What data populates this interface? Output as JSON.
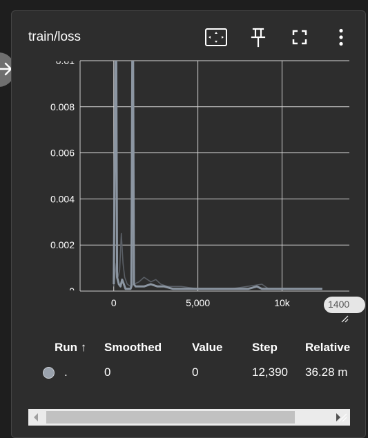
{
  "card": {
    "title": "train/loss"
  },
  "toolbar": {
    "fit_icon": "fit-domain-icon",
    "pin_icon": "pin-icon",
    "fullscreen_icon": "fullscreen-icon",
    "more_icon": "more-vert-icon"
  },
  "sidebar_toggle_icon": "arrow-right-icon",
  "chart_data": {
    "type": "line",
    "title": "",
    "xlabel": "",
    "ylabel": "",
    "xlim": [
      -2000,
      14000
    ],
    "ylim": [
      0,
      0.01
    ],
    "x_ticks": [
      "0",
      "5,000",
      "10k",
      "1400"
    ],
    "y_ticks": [
      "0.01",
      "0.008",
      "0.006",
      "0.004",
      "0.002",
      "0"
    ],
    "grid": true,
    "series": [
      {
        "name": "",
        "color": "#8c96a2",
        "x": [
          0,
          100,
          150,
          200,
          300,
          400,
          500,
          600,
          700,
          750,
          800,
          900,
          1000,
          1050,
          1100,
          1150,
          1200,
          1300,
          1500,
          1800,
          2200,
          2600,
          3000,
          3500,
          4000,
          5000,
          6000,
          7000,
          7700,
          8000,
          8500,
          8800,
          9000,
          10000,
          11000,
          12390
        ],
        "y": [
          0.0003,
          0.01,
          0.01,
          0.0006,
          0.0003,
          0.0002,
          0.0005,
          0.0003,
          0.0001,
          0.0001,
          0.0001,
          0.0001,
          0.0001,
          0.0002,
          0.01,
          0.01,
          0.0003,
          0.0002,
          0.0002,
          0.0002,
          0.0003,
          0.0002,
          0.0002,
          0.0001,
          0.0001,
          0.0001,
          0.0001,
          0.0001,
          0.0001,
          0.0001,
          0.0002,
          0.0001,
          0.0001,
          0.0001,
          0.0001,
          0.0001
        ]
      },
      {
        "name": "",
        "color": "#5a5f66",
        "x": [
          0,
          150,
          250,
          350,
          450,
          550,
          650,
          800,
          1000,
          1200,
          1500,
          1800,
          2200,
          2500,
          2800,
          3200,
          4000,
          5000,
          7000,
          8800,
          9200,
          10000,
          12390
        ],
        "y": [
          0.0002,
          0.0012,
          0.0006,
          0.0009,
          0.0025,
          0.0012,
          0.0006,
          0.0003,
          0.0002,
          0.0003,
          0.0004,
          0.0006,
          0.0004,
          0.0005,
          0.0003,
          0.0002,
          0.0002,
          0.0001,
          0.0001,
          0.0003,
          0.0001,
          0.0001,
          0.0001
        ]
      }
    ]
  },
  "x_overflow_label": "1400",
  "table": {
    "headers": {
      "run": "Run ↑",
      "smoothed": "Smoothed",
      "value": "Value",
      "step": "Step",
      "relative": "Relative"
    },
    "rows": [
      {
        "color": "#9aa2ad",
        "run": ".",
        "smoothed": "0",
        "value": "0",
        "step": "12,390",
        "relative": "36.28 m"
      }
    ]
  }
}
